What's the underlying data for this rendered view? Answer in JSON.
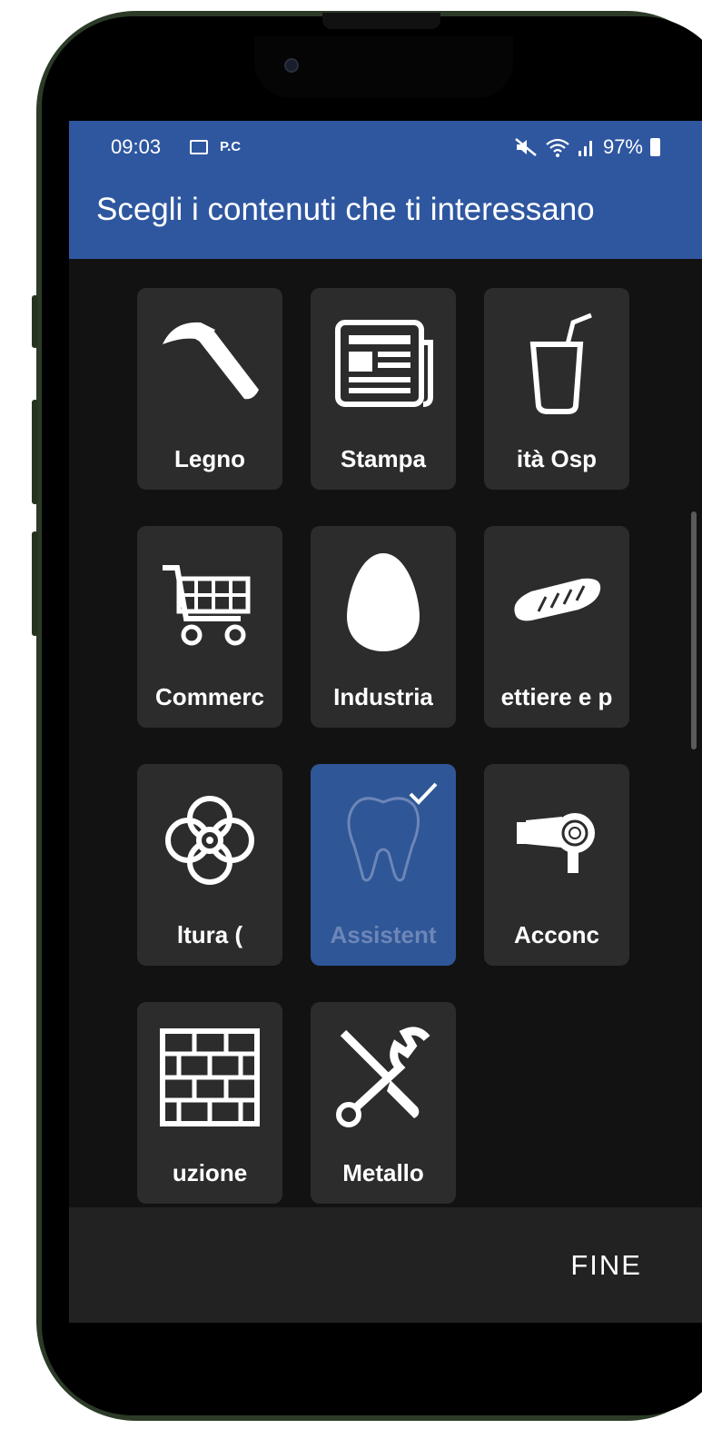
{
  "status_bar": {
    "time": "09:03",
    "left_icons": [
      "gallery-icon",
      "pc-icon"
    ],
    "pc_text": "P.C",
    "right_icons": [
      "mute-icon",
      "wifi-icon",
      "signal-icon",
      "battery-icon"
    ],
    "battery": "97%"
  },
  "header": {
    "title": "Scegli i contenuti che ti interessano"
  },
  "tiles": [
    {
      "label": "Legno",
      "icon": "hammer-icon",
      "selected": false
    },
    {
      "label": "Stampa",
      "icon": "newspaper-icon",
      "selected": false
    },
    {
      "label": "ità    Osp",
      "icon": "drink-cup-icon",
      "selected": false
    },
    {
      "label": "Commerc",
      "icon": "shopping-cart-icon",
      "selected": false
    },
    {
      "label": "Industria",
      "icon": "egg-icon",
      "selected": false
    },
    {
      "label": "ettiere e p",
      "icon": "bread-icon",
      "selected": false
    },
    {
      "label": "ltura     (",
      "icon": "flower-icon",
      "selected": false
    },
    {
      "label": "Assistent",
      "icon": "tooth-icon",
      "selected": true
    },
    {
      "label": "Acconc",
      "icon": "hair-dryer-icon",
      "selected": false
    },
    {
      "label": "uzione",
      "icon": "brick-wall-icon",
      "selected": false
    },
    {
      "label": "Metallo",
      "icon": "tools-icon",
      "selected": false
    }
  ],
  "footer": {
    "done_label": "FINE"
  },
  "colors": {
    "accent": "#2f57a0",
    "background": "#121212",
    "tile": "#2c2c2c",
    "selected_tile": "#2f5696"
  }
}
